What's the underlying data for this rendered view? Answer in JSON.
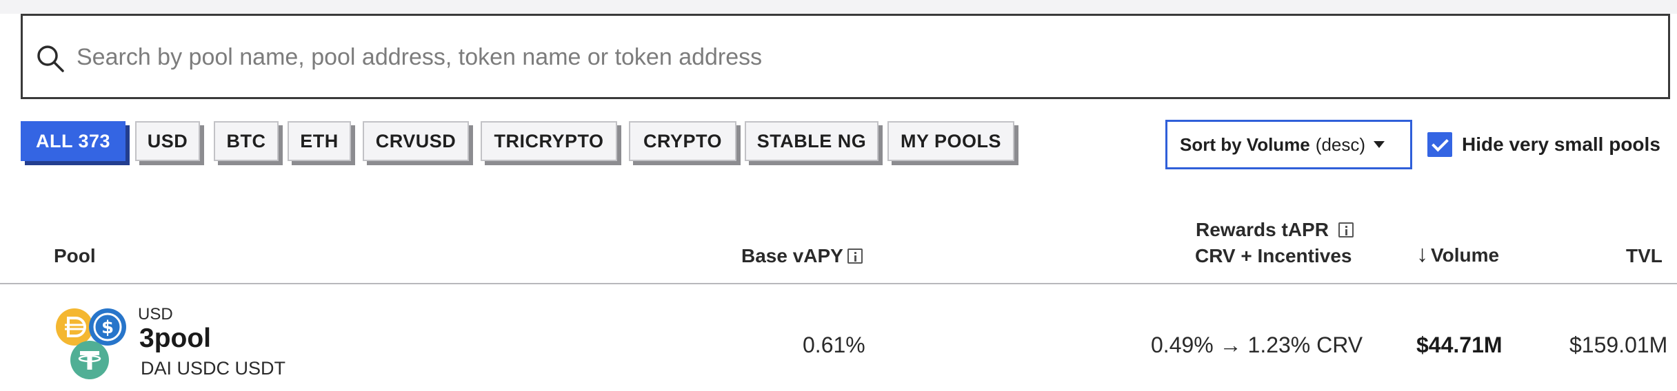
{
  "search": {
    "placeholder": "Search by pool name, pool address, token name or token address",
    "value": ""
  },
  "filters": [
    {
      "label": "ALL 373",
      "active": true
    },
    {
      "label": "USD"
    },
    {
      "label": "BTC"
    },
    {
      "label": "ETH"
    },
    {
      "label": "CRVUSD"
    },
    {
      "label": "TRICRYPTO"
    },
    {
      "label": "CRYPTO"
    },
    {
      "label": "STABLE NG"
    },
    {
      "label": "MY POOLS"
    }
  ],
  "sort": {
    "label": "Sort by Volume",
    "direction": "(desc)"
  },
  "hide_small": {
    "label": "Hide very small pools",
    "checked": true
  },
  "columns": {
    "pool": "Pool",
    "base_vapy": "Base vAPY",
    "rewards_line1": "Rewards tAPR",
    "rewards_line2": "CRV + Incentives",
    "volume_arrow": "↓",
    "volume": "Volume",
    "tvl": "TVL"
  },
  "rows": [
    {
      "category": "USD",
      "name": "3pool",
      "tokens": "DAI USDC USDT",
      "base_vapy": "0.61%",
      "rewards": "0.49% → 1.23% CRV",
      "volume": "$44.71M",
      "tvl": "$159.01M"
    }
  ],
  "colors": {
    "accent": "#3465e3",
    "dai": "#f4b731",
    "usdc": "#2775ca",
    "usdt": "#50af95"
  },
  "icons": [
    "search-icon",
    "info-icon",
    "caret-down-icon",
    "check-icon",
    "dai-icon",
    "usdc-icon",
    "usdt-icon"
  ]
}
